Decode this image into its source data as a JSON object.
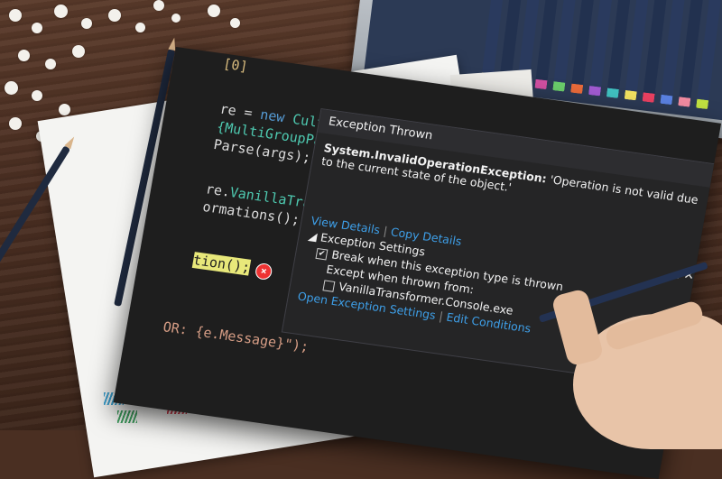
{
  "editor": {
    "top_fragment": "[0]",
    "lines": [
      {
        "a": "re = ",
        "kw": "new",
        "ty": " Cultu"
      },
      {
        "a": "",
        "ty": "{MultiGroupParse"
      },
      {
        "a": "Parse(args);"
      },
      {
        "a": "re.",
        "ty": "VanillaTran"
      },
      {
        "a": "ormations();"
      },
      {
        "hl": "tion();"
      },
      {
        "a": "OR: {e.Message}\");"
      }
    ]
  },
  "popup": {
    "title": "Exception Thrown",
    "exception_type": "System.InvalidOperationException:",
    "message": "'Operation is not valid due to the current state of the object.'",
    "view_details": "View Details",
    "copy_details": "Copy Details",
    "settings_header": "Exception Settings",
    "break_when": "Break when this exception type is thrown",
    "except_when": "Except when thrown from:",
    "module": "VanillaTransformer.Console.exe",
    "open_settings": "Open Exception Settings",
    "edit_conditions": "Edit Conditions",
    "break_checked": true,
    "module_checked": false
  },
  "colors": {
    "link": "#3e9fe8",
    "editor_bg": "#1e1e1e",
    "popup_bg": "#252526"
  }
}
